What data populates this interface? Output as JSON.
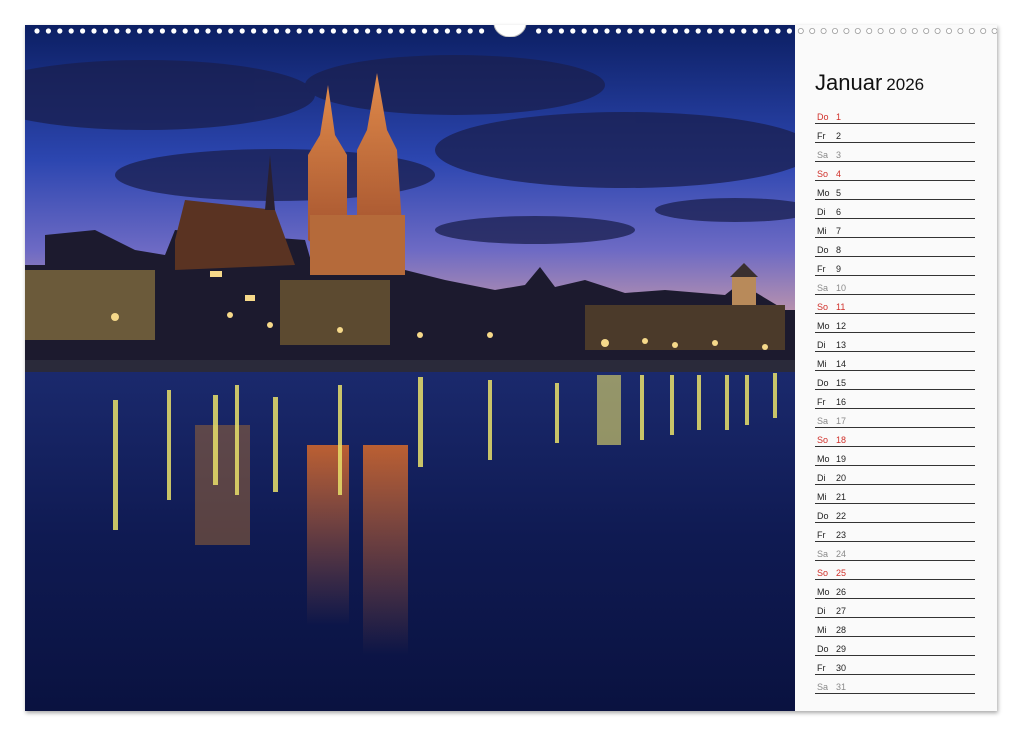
{
  "month": {
    "name": "Januar",
    "year": "2026"
  },
  "colors": {
    "sunday": "#d0302a",
    "saturday": "#8a8a8a",
    "weekday": "#222222",
    "rule": "#333333"
  },
  "days": [
    {
      "wd": "Do",
      "d": "1",
      "type": "sun"
    },
    {
      "wd": "Fr",
      "d": "2",
      "type": "wd"
    },
    {
      "wd": "Sa",
      "d": "3",
      "type": "sat"
    },
    {
      "wd": "So",
      "d": "4",
      "type": "sun"
    },
    {
      "wd": "Mo",
      "d": "5",
      "type": "wd"
    },
    {
      "wd": "Di",
      "d": "6",
      "type": "wd"
    },
    {
      "wd": "Mi",
      "d": "7",
      "type": "wd"
    },
    {
      "wd": "Do",
      "d": "8",
      "type": "wd"
    },
    {
      "wd": "Fr",
      "d": "9",
      "type": "wd"
    },
    {
      "wd": "Sa",
      "d": "10",
      "type": "sat"
    },
    {
      "wd": "So",
      "d": "11",
      "type": "sun"
    },
    {
      "wd": "Mo",
      "d": "12",
      "type": "wd"
    },
    {
      "wd": "Di",
      "d": "13",
      "type": "wd"
    },
    {
      "wd": "Mi",
      "d": "14",
      "type": "wd"
    },
    {
      "wd": "Do",
      "d": "15",
      "type": "wd"
    },
    {
      "wd": "Fr",
      "d": "16",
      "type": "wd"
    },
    {
      "wd": "Sa",
      "d": "17",
      "type": "sat"
    },
    {
      "wd": "So",
      "d": "18",
      "type": "sun"
    },
    {
      "wd": "Mo",
      "d": "19",
      "type": "wd"
    },
    {
      "wd": "Di",
      "d": "20",
      "type": "wd"
    },
    {
      "wd": "Mi",
      "d": "21",
      "type": "wd"
    },
    {
      "wd": "Do",
      "d": "22",
      "type": "wd"
    },
    {
      "wd": "Fr",
      "d": "23",
      "type": "wd"
    },
    {
      "wd": "Sa",
      "d": "24",
      "type": "sat"
    },
    {
      "wd": "So",
      "d": "25",
      "type": "sun"
    },
    {
      "wd": "Mo",
      "d": "26",
      "type": "wd"
    },
    {
      "wd": "Di",
      "d": "27",
      "type": "wd"
    },
    {
      "wd": "Mi",
      "d": "28",
      "type": "wd"
    },
    {
      "wd": "Do",
      "d": "29",
      "type": "wd"
    },
    {
      "wd": "Fr",
      "d": "30",
      "type": "wd"
    },
    {
      "wd": "Sa",
      "d": "31",
      "type": "sat"
    }
  ]
}
